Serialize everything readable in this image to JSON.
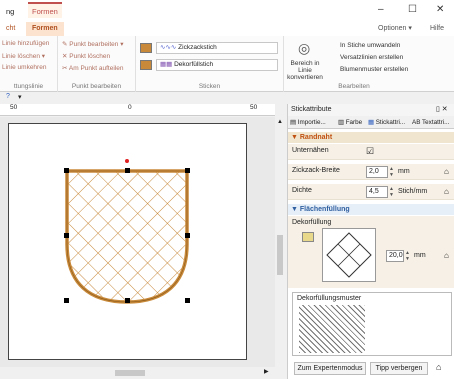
{
  "window": {
    "tabs": [
      "ng",
      "Formen"
    ],
    "minimize": "–",
    "maximize": "☐",
    "close": "✕"
  },
  "ribbon_tabs": {
    "left": "cht",
    "active": "Formen",
    "right_options": "Optionen",
    "right_help": "Hilfe",
    "options_arrow": "▾"
  },
  "ribbon": {
    "line_group": {
      "items": [
        "Linie hinzufügen",
        "Linie löschen ▾",
        "Linie umkehren"
      ],
      "label": "ttungslinie"
    },
    "point_group": {
      "items": [
        "Punkt bearbeiten ▾",
        "Punkt löschen",
        "Am Punkt aufteilen"
      ],
      "label": "Punkt bearbeiten"
    },
    "stitch_group": {
      "combo1": "Zickzackstich",
      "combo2": "Dekorfüllstich",
      "label": "Sticken"
    },
    "edit_group": {
      "big_button": "Bereich in Linie konvertieren",
      "items": [
        "In Stiche umwandeln",
        "Versatzlinien erstellen",
        "Blumenmuster erstellen"
      ],
      "label": "Bearbeiten"
    }
  },
  "qat": {
    "help_icon": "?",
    "more": "▾"
  },
  "ruler": {
    "ticks": [
      "50",
      "0",
      "50"
    ]
  },
  "panel": {
    "title": "Stickattribute",
    "pin": "▯ ✕",
    "tabs": [
      "Importie...",
      "Farbe",
      "Stickattri...",
      "AB Textattri..."
    ],
    "satin_section": "▼ Randnaht",
    "rows": [
      {
        "label": "Unternähen",
        "value": "☑"
      },
      {
        "label": "Zickzack-Breite",
        "value": "2,0",
        "unit": "mm"
      },
      {
        "label": "Dichte",
        "value": "4,5",
        "unit": "Stich/mm"
      }
    ],
    "fill_section": "▼ Flächenfüllung",
    "fill_label": "Dekorfüllung",
    "fill_size": "20,0",
    "fill_unit": "mm",
    "pattern_label": "Dekorfüllungsmuster",
    "expert_button": "Zum Expertenmodus",
    "hint_button": "Tipp verbergen"
  },
  "colors": {
    "outline": "#c8893a",
    "accent": "#c0504d",
    "section_orange": "#c05010",
    "section_blue": "#3060a0"
  }
}
